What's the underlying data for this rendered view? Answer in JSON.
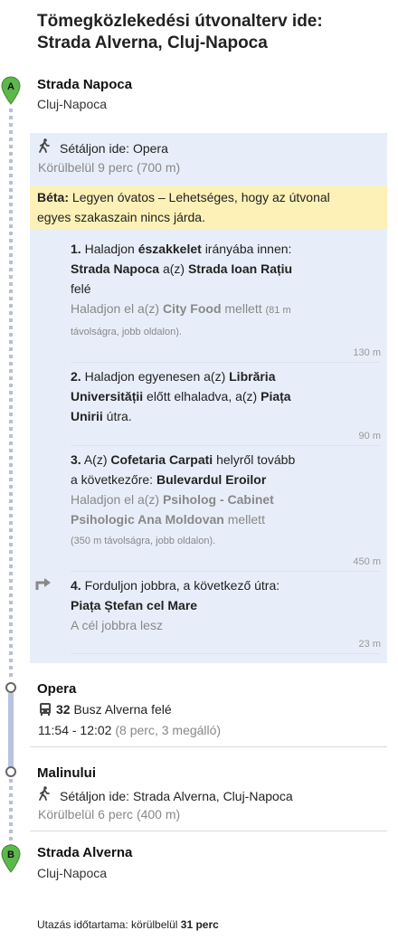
{
  "title": {
    "line1": "Tömegközlekedési útvonalterv ide:",
    "line2": "Strada Alverna, Cluj-Napoca"
  },
  "start": {
    "marker": "A",
    "name": "Strada Napoca",
    "city": "Cluj-Napoca"
  },
  "walk1": {
    "prefix": "Sétáljon ide:",
    "destination": "Opera",
    "duration": "Körülbelül 9 perc (700 m)"
  },
  "beta": {
    "label": "Béta:",
    "text_line1": "Legyen óvatos – Lehetséges, hogy az útvonal",
    "text_line2": "egyes szakaszain nincs járda."
  },
  "steps": [
    {
      "num": "1.",
      "t1": "Haladjon",
      "t2": "északkelet",
      "t3": "irányába innen:",
      "t4": "Strada Napoca",
      "t5": "a(z)",
      "t6": "Strada Ioan Rațiu",
      "t7": "felé",
      "note1": "Haladjon el a(z)",
      "note2": "City Food",
      "note3": "mellett",
      "note4": "(81 m",
      "note5": "távolságra, jobb oldalon).",
      "distance": "130 m"
    },
    {
      "num": "2.",
      "t1": "Haladjon egyenesen a(z)",
      "t2": "Librăria",
      "t3": "Universității",
      "t4": "előtt elhaladva, a(z)",
      "t5": "Piața",
      "t6": "Unirii",
      "t7": "útra.",
      "distance": "90 m"
    },
    {
      "num": "3.",
      "t1": "A(z)",
      "t2": "Cofetaria Carpati",
      "t3": "helyről tovább",
      "t4": "a következőre:",
      "t5": "Bulevardul Eroilor",
      "note1": "Haladjon el a(z)",
      "note2": "Psiholog - Cabinet",
      "note3": "Psihologic Ana Moldovan",
      "note4": "mellett",
      "note5": "(350 m távolságra, jobb oldalon).",
      "distance": "450 m"
    },
    {
      "num": "4.",
      "t1": "Forduljon jobbra, a következő útra:",
      "t2": "Piața Ștefan cel Mare",
      "note1": "A cél jobbra lesz",
      "distance": "23 m"
    }
  ],
  "stop1": {
    "name": "Opera",
    "bus_number": "32",
    "bus_text": "Busz Alverna felé",
    "times": "11:54 - 12:02",
    "times_note": "(8 perc, 3 megálló)"
  },
  "stop2": {
    "name": "Malinului",
    "walk_prefix": "Sétáljon ide:",
    "walk_dest": "Strada Alverna, Cluj-Napoca",
    "duration": "Körülbelül 6 perc (400 m)"
  },
  "end": {
    "marker": "B",
    "name": "Strada Alverna",
    "city": "Cluj-Napoca"
  },
  "footer": {
    "label": "Utazás időtartama: körülbelül",
    "value": "31 perc"
  },
  "colors": {
    "pin": "#5cb84a",
    "walk_box": "#e8eef9",
    "beta_bg": "#fdf1b8",
    "transit_line": "#b9c3e1"
  }
}
